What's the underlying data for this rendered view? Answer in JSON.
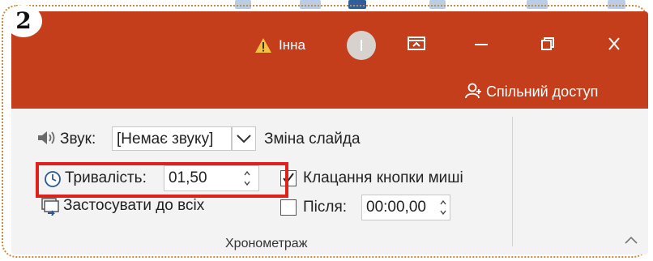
{
  "badge": {
    "number": "2"
  },
  "titlebar": {
    "user_name": "Інна",
    "warning_icon": "warning-icon",
    "avatar_icon": "avatar-icon",
    "colors": {
      "titlebar": "#c43e1c",
      "ribbon": "#f3f3f3",
      "highlight": "#e0201a"
    }
  },
  "share": {
    "label": "Спільний доступ",
    "icon": "share-person-icon"
  },
  "ribbon": {
    "sound_label": "Звук:",
    "sound_value": "[Немає звуку]",
    "slide_change_label": "Зміна слайда",
    "duration_label": "Тривалість:",
    "duration_value": "01,50",
    "mouse_click_label": "Клацання кнопки миші",
    "mouse_click_checked": true,
    "apply_all_label": "Застосувати до всіх",
    "after_label": "Після:",
    "after_value": "00:00,00",
    "after_checked": false,
    "group_label": "Хронометраж"
  }
}
